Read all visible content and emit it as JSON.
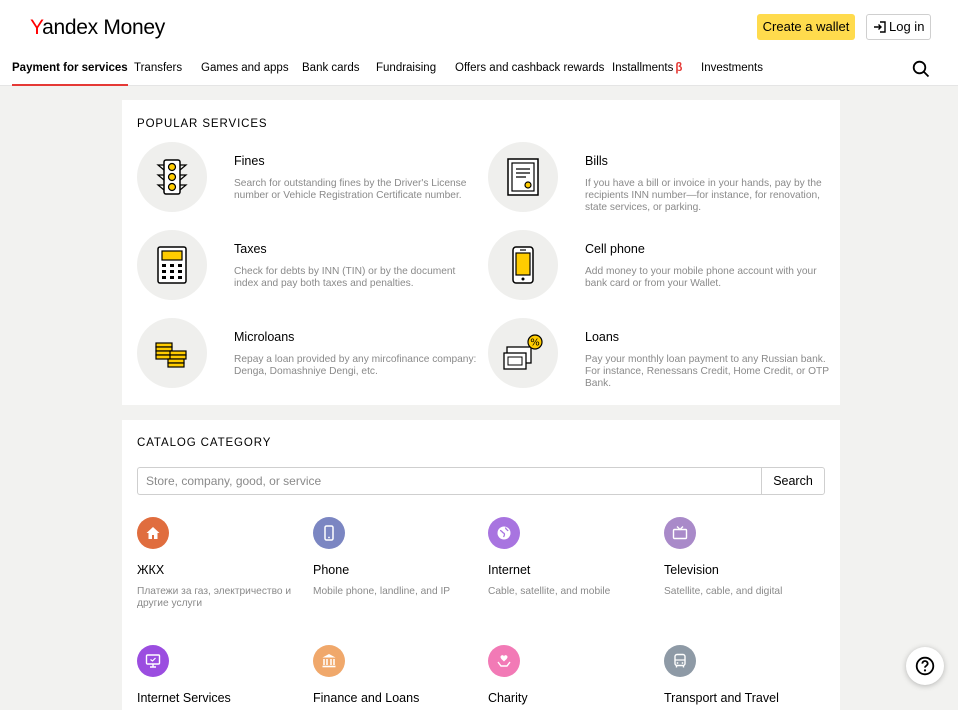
{
  "header": {
    "logo_y": "Y",
    "logo_rest": "andex Money",
    "create_wallet": "Create a wallet",
    "log_in": "Log in"
  },
  "nav": {
    "items": [
      {
        "label": "Payment for services",
        "active": true
      },
      {
        "label": "Transfers"
      },
      {
        "label": "Games and apps"
      },
      {
        "label": "Bank cards"
      },
      {
        "label": "Fundraising"
      },
      {
        "label": "Offers and cashback rewards"
      },
      {
        "label": "Installments"
      },
      {
        "label": "Investments"
      }
    ],
    "beta_mark": "β"
  },
  "popular": {
    "title": "POPULAR SERVICES",
    "items": [
      {
        "title": "Fines",
        "desc": "Search for outstanding fines by the Driver's License number or Vehicle Registration Certificate number.",
        "icon": "traffic-light-icon"
      },
      {
        "title": "Bills",
        "desc": "If you have a bill or invoice in your hands, pay by the recipients INN number—for instance, for renovation, state services, or parking.",
        "icon": "bill-icon"
      },
      {
        "title": "Taxes",
        "desc": "Check for debts by INN (TIN) or by the document index and pay both taxes and penalties.",
        "icon": "calculator-icon"
      },
      {
        "title": "Cell phone",
        "desc": "Add money to your mobile phone account with your bank card or from your Wallet.",
        "icon": "phone-icon"
      },
      {
        "title": "Microloans",
        "desc": "Repay a loan provided by any mircofinance company: Denga, Domashniye Dengi, etc.",
        "icon": "coins-icon"
      },
      {
        "title": "Loans",
        "desc": "Pay your monthly loan payment to any Russian bank. For instance, Renessans Credit, Home Credit, or OTP Bank.",
        "icon": "loan-percent-icon"
      }
    ]
  },
  "catalog": {
    "title": "CATALOG CATEGORY",
    "search_placeholder": "Store, company, good, or service",
    "search_button": "Search",
    "items": [
      {
        "title": "ЖКХ",
        "desc": "Платежи за газ, электричество и другие услуги",
        "color": "#e06d3e",
        "icon": "house-icon"
      },
      {
        "title": "Phone",
        "desc": "Mobile phone, landline, and IP",
        "color": "#7b86c2",
        "icon": "mobile-icon"
      },
      {
        "title": "Internet",
        "desc": "Cable, satellite, and mobile",
        "color": "#a874e0",
        "icon": "globe-icon"
      },
      {
        "title": "Television",
        "desc": "Satellite, cable, and digital",
        "color": "#a98ac9",
        "icon": "tv-icon"
      },
      {
        "title": "Internet Services",
        "desc": "",
        "color": "#9b4de0",
        "icon": "monitor-icon"
      },
      {
        "title": "Finance and Loans",
        "desc": "",
        "color": "#f0a86b",
        "icon": "bank-icon"
      },
      {
        "title": "Charity",
        "desc": "",
        "color": "#f27ab6",
        "icon": "heart-hand-icon"
      },
      {
        "title": "Transport and Travel",
        "desc": "",
        "color": "#8e9aa6",
        "icon": "bus-icon"
      }
    ]
  },
  "help": {
    "icon": "question-icon"
  }
}
